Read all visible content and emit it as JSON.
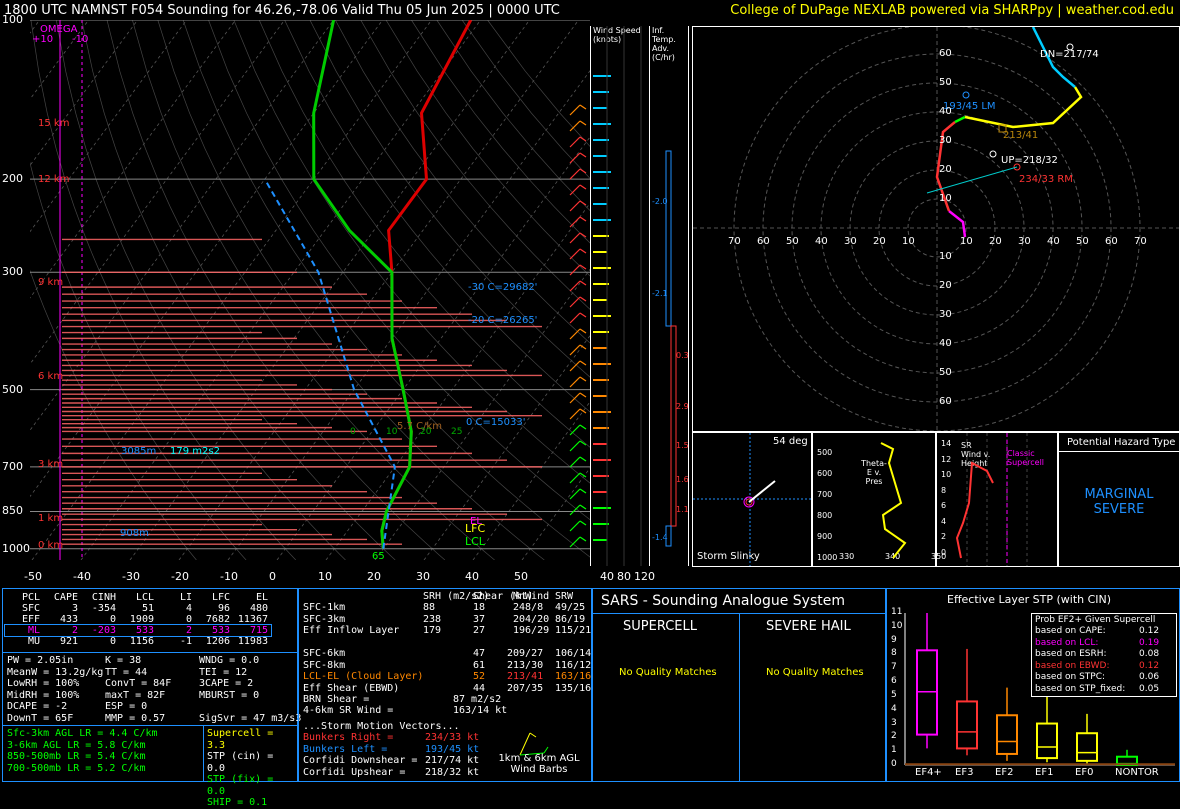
{
  "header": {
    "title": "1800 UTC NAMNST F054 Sounding for 46.26,-78.06 Valid  Thu 05 Jun 2025 | 0000 UTC",
    "credit": "College of DuPage NEXLAB powered via SHARPpy | weather.cod.edu"
  },
  "skewt": {
    "pressure_ticks": [
      "100",
      "200",
      "300",
      "500",
      "700",
      "850",
      "1000"
    ],
    "temp_ticks": [
      "-50",
      "-40",
      "-30",
      "-20",
      "-10",
      "0",
      "10",
      "20",
      "30",
      "40",
      "50"
    ],
    "height_labels": [
      "15 km",
      "12 km",
      "9 km",
      "6 km",
      "3 km",
      "1 km",
      "0 km"
    ],
    "omega_title": "OMEGA",
    "omega_plus": "+10",
    "omega_minus": "-10",
    "annotations": {
      "m30": "-30 C=29682'",
      "m20": "-20 C=26265'",
      "zero": "0 C=15033'",
      "lapse": "5.7 C/km",
      "h3085": "3085m",
      "srh": "179 m2s2",
      "h908": "908m",
      "lfc": "LFC",
      "lcl": "LCL",
      "el": "EL",
      "wetbulb": "65",
      "lr_ticks": [
        "0",
        "10",
        "20",
        "25"
      ]
    }
  },
  "wind_speed": {
    "title": "Wind Speed (knots)",
    "ticks": [
      "40",
      "80",
      "120"
    ]
  },
  "inf_temp": {
    "title": "Inf. Temp. Adv. (C/hr)",
    "values": [
      "-2.0",
      "-2.1",
      "0.3",
      "2.9",
      "1.5",
      "1.6",
      "1.1",
      "-1.4"
    ]
  },
  "hodograph": {
    "ring_labels": [
      "60",
      "50",
      "40",
      "30",
      "20",
      "10"
    ],
    "axis_labels_left": [
      "70",
      "60",
      "50",
      "40",
      "30",
      "20",
      "10"
    ],
    "axis_labels_right": [
      "10",
      "20",
      "30",
      "40",
      "50",
      "60",
      "70"
    ],
    "labels": {
      "dn": "DN=217/74",
      "lm": "193/45 LM",
      "mean": "213/41",
      "up": "UP=218/32",
      "rm": "234/33 RM"
    }
  },
  "storm_slinky": {
    "title": "Storm Slinky",
    "deg": "54 deg"
  },
  "theta": {
    "title": "Theta-E v. Pres",
    "pres": [
      "500",
      "600",
      "700",
      "800",
      "900",
      "1000"
    ],
    "xticks": [
      "330",
      "340",
      "350"
    ]
  },
  "sr_wind": {
    "title": "SR Wind v. Height",
    "yticks": [
      "14",
      "12",
      "10",
      "8",
      "6",
      "4",
      "2",
      "0"
    ],
    "note": "Classic Supercell"
  },
  "hazard": {
    "title": "Potential Hazard Type",
    "value": "MARGINAL SEVERE"
  },
  "parcels": {
    "headers": [
      "PCL",
      "CAPE",
      "CINH",
      "LCL",
      "LI",
      "LFC",
      "EL"
    ],
    "rows": [
      [
        "SFC",
        "3",
        "-354",
        "51",
        "4",
        "96",
        "480"
      ],
      [
        "EFF",
        "433",
        "0",
        "1909",
        "0",
        "7682",
        "11367"
      ],
      [
        "ML",
        "2",
        "-203",
        "533",
        "2",
        "533",
        "715"
      ],
      [
        "MU",
        "921",
        "0",
        "1156",
        "-1",
        "1206",
        "11983"
      ]
    ]
  },
  "indices": {
    "col1": [
      "PW = 2.05in",
      "MeanW = 13.2g/kg",
      "LowRH = 100%",
      "MidRH = 100%",
      "DCAPE = -2",
      "DownT = 65F"
    ],
    "col2": [
      "K = 38",
      "TT = 44",
      "ConvT = 84F",
      "maxT = 82F",
      "ESP = 0",
      "MMP = 0.57"
    ],
    "col3": [
      "WNDG = 0.0",
      "TEI = 12",
      "3CAPE = 2",
      "MBURST = 0",
      "",
      "SigSvr = 47 m3/s3"
    ],
    "lapse": [
      "Sfc-3km AGL LR = 4.4 C/km",
      "3-6km AGL LR = 5.8 C/km",
      "850-500mb LR = 5.4 C/km",
      "700-500mb LR = 5.2 C/km"
    ],
    "composite": [
      "Supercell = 3.3",
      "STP (cin) = 0.0",
      "STP (fix) = 0.0",
      "SHIP = 0.1"
    ]
  },
  "kinematics": {
    "headers": [
      "",
      "SRH (m2/s2)",
      "Shear (kt)",
      "MnWind",
      "SRW"
    ],
    "rows": [
      [
        "SFC-1km",
        "88",
        "18",
        "248/8",
        "49/25"
      ],
      [
        "SFC-3km",
        "238",
        "37",
        "204/20",
        "86/19"
      ],
      [
        "Eff Inflow Layer",
        "179",
        "27",
        "196/29",
        "115/21"
      ],
      [
        "",
        "",
        "",
        "",
        ""
      ],
      [
        "SFC-6km",
        "47",
        "209/27",
        "106/14"
      ],
      [
        "SFC-8km",
        "61",
        "213/30",
        "116/12"
      ],
      [
        "LCL-EL (Cloud Layer)",
        "52",
        "213/41",
        "163/16"
      ],
      [
        "Eff Shear (EBWD)",
        "44",
        "207/35",
        "135/16"
      ]
    ],
    "brn": [
      "BRN Shear =",
      "87 m2/s2"
    ],
    "sr4": [
      "4-6km SR Wind =",
      "163/14 kt"
    ],
    "vectors_title": "...Storm Motion Vectors...",
    "vectors": [
      [
        "Bunkers Right =",
        "234/33 kt"
      ],
      [
        "Bunkers Left =",
        "193/45 kt"
      ],
      [
        "Corfidi Downshear =",
        "217/74 kt"
      ],
      [
        "Corfidi Upshear =",
        "218/32 kt"
      ]
    ],
    "barbs_label": "1km & 6km AGL Wind Barbs"
  },
  "sars": {
    "title": "SARS - Sounding Analogue System",
    "supercell": "SUPERCELL",
    "hail": "SEVERE HAIL",
    "supercell_match": "No Quality Matches",
    "hail_match": "No Quality Matches"
  },
  "stp": {
    "title": "Effective Layer STP (with CIN)",
    "yticks": [
      "11",
      "10",
      "9",
      "8",
      "7",
      "6",
      "5",
      "4",
      "3",
      "2",
      "1",
      "0"
    ],
    "categories": [
      "EF4+",
      "EF3",
      "EF2",
      "EF1",
      "EF0",
      "NONTOR"
    ],
    "prob_title": "Prob EF2+ Given Supercell",
    "prob_rows": [
      [
        "based on CAPE:",
        "0.12"
      ],
      [
        "based on LCL:",
        "0.19"
      ],
      [
        "based on ESRH:",
        "0.08"
      ],
      [
        "based on EBWD:",
        "0.12"
      ],
      [
        "based on STPC:",
        "0.06"
      ],
      [
        "based on STP_fixed:",
        "0.05"
      ]
    ]
  },
  "chart_data": [
    {
      "type": "line",
      "title": "Skew-T Sounding",
      "ylabel": "Pressure (mb)",
      "xlabel": "Temperature (C)",
      "xlim": [
        -50,
        50
      ],
      "ylim": [
        1000,
        100
      ],
      "series": [
        {
          "name": "Temperature",
          "x": [
            20,
            17,
            15,
            13,
            8,
            0,
            -10,
            -20,
            -27,
            -27,
            -38,
            -42
          ],
          "y": [
            1000,
            925,
            850,
            700,
            600,
            500,
            400,
            300,
            250,
            200,
            150,
            100
          ]
        },
        {
          "name": "Dewpoint",
          "x": [
            20,
            17,
            15,
            13,
            8,
            0,
            -10,
            -20,
            -35,
            -50,
            -60,
            -70
          ],
          "y": [
            1000,
            925,
            850,
            700,
            600,
            500,
            400,
            300,
            250,
            200,
            150,
            100
          ]
        }
      ]
    },
    {
      "type": "bar",
      "title": "Effective Layer STP (with CIN)",
      "categories": [
        "EF4+",
        "EF3",
        "EF2",
        "EF1",
        "EF0",
        "NONTOR"
      ],
      "series": [
        {
          "name": "p10",
          "values": [
            1.2,
            0.7,
            0.3,
            0.2,
            0.1,
            0.0
          ]
        },
        {
          "name": "q1",
          "values": [
            2.2,
            1.2,
            0.8,
            0.5,
            0.3,
            0.0
          ]
        },
        {
          "name": "median",
          "values": [
            5.3,
            2.4,
            1.7,
            1.3,
            0.9,
            0.1
          ]
        },
        {
          "name": "q3",
          "values": [
            8.3,
            4.6,
            3.6,
            3.0,
            2.3,
            0.6
          ]
        },
        {
          "name": "p90",
          "values": [
            11.0,
            8.4,
            5.6,
            5.1,
            3.7,
            1.1
          ]
        }
      ],
      "ylim": [
        0,
        11
      ]
    }
  ]
}
